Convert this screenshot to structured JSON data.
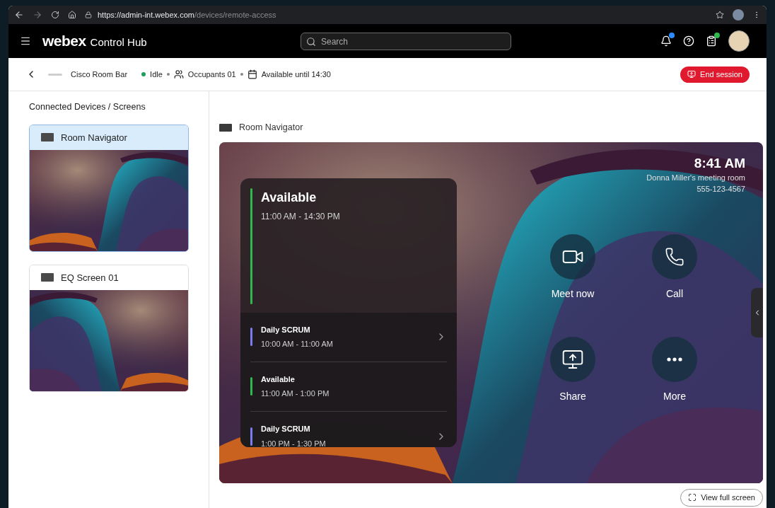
{
  "browser": {
    "url_host": "https://admin-int.webex.com",
    "url_path": "/devices/remote-access"
  },
  "header": {
    "brand": "webex",
    "product": "Control Hub",
    "search": {
      "placeholder": "Search"
    },
    "notification_badge": true,
    "tasks_badge": true
  },
  "device_bar": {
    "name": "Cisco Room Bar",
    "status": "Idle",
    "occupants": "Occupants 01",
    "availability": "Available until 14:30",
    "end_button": "End session"
  },
  "sidebar": {
    "title": "Connected Devices / Screens",
    "devices": [
      {
        "name": "Room Navigator",
        "selected": true,
        "kind": "navigator"
      },
      {
        "name": "EQ Screen 01",
        "selected": false,
        "kind": "screen"
      }
    ]
  },
  "preview": {
    "title": "Room Navigator",
    "time": "8:41 AM",
    "room": "Donna Miller's meeting room",
    "phone": "555-123-4567",
    "schedule": {
      "current": {
        "title": "Available",
        "time": "11:00 AM - 14:30 PM",
        "color": "#2fb84d"
      },
      "items": [
        {
          "title": "Daily SCRUM",
          "time": "10:00 AM - 11:00 AM",
          "color": "#7b7bf0",
          "has_arrow": true
        },
        {
          "title": "Available",
          "time": "11:00 AM - 1:00 PM",
          "color": "#2fb84d",
          "has_arrow": false
        },
        {
          "title": "Daily SCRUM",
          "time": "1:00 PM - 1:30 PM",
          "color": "#7b7bf0",
          "has_arrow": true
        }
      ]
    },
    "actions": [
      {
        "label": "Meet now",
        "kind": "video"
      },
      {
        "label": "Call",
        "kind": "phone"
      },
      {
        "label": "Share",
        "kind": "share"
      },
      {
        "label": "More",
        "kind": "more"
      }
    ],
    "view_button": "View full screen"
  }
}
